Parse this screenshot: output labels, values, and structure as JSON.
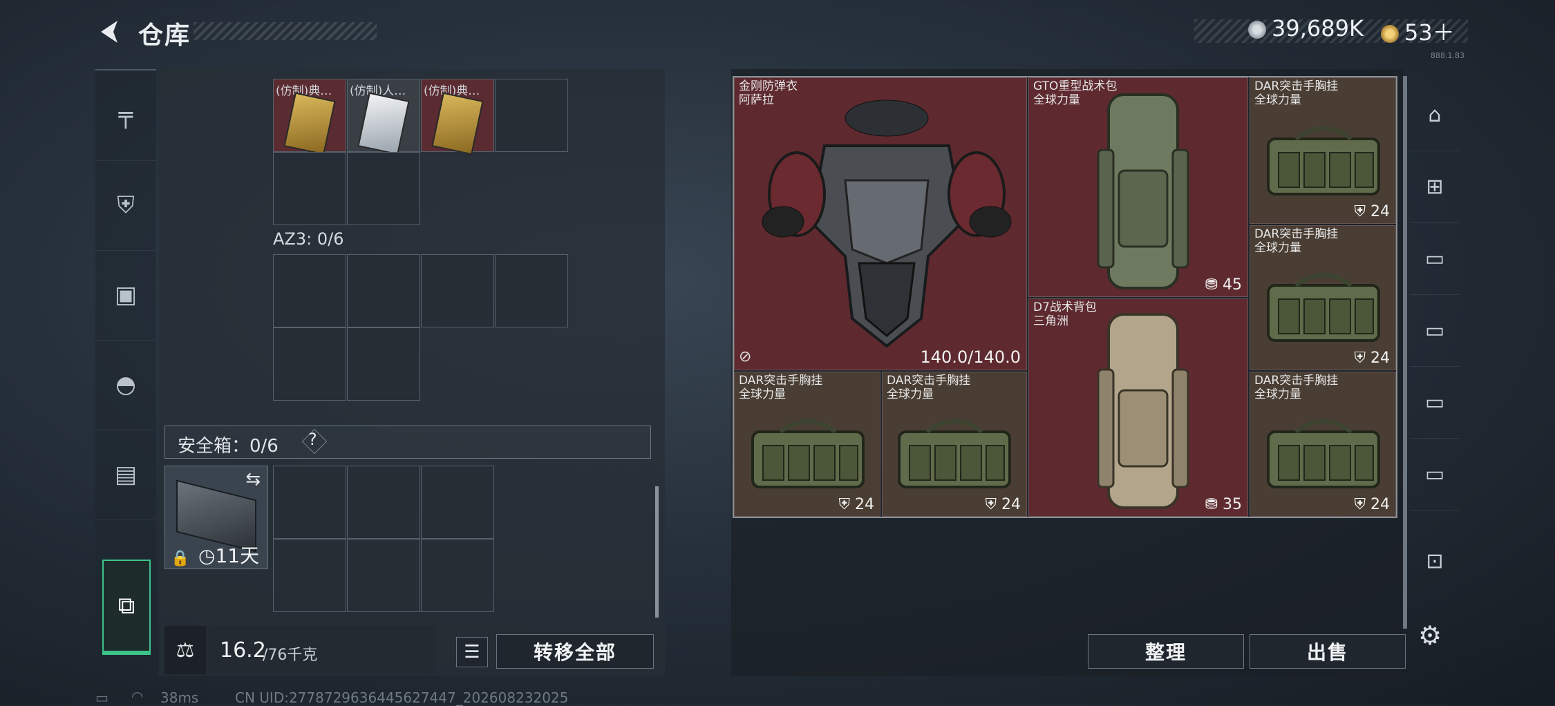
{
  "header": {
    "title": "仓库",
    "currency1_value": "39,689K",
    "currency2_value": "53＋",
    "version": "888.1.83"
  },
  "sidebar": {
    "items": [
      {
        "name": "weapon-icon",
        "glyph": "╤"
      },
      {
        "name": "armor-icon",
        "glyph": "⛨"
      },
      {
        "name": "backpack-icon",
        "glyph": "▣"
      },
      {
        "name": "helmet-icon",
        "glyph": "◓"
      },
      {
        "name": "rig-icon",
        "glyph": "▤"
      },
      {
        "name": "toolbox-icon",
        "glyph": "⧉"
      }
    ]
  },
  "left": {
    "top_items": [
      {
        "label": "(仿制)典…"
      },
      {
        "label": "(仿制)人…"
      },
      {
        "label": "(仿制)典…"
      }
    ],
    "az3_label": "AZ3: 0/6",
    "safebox_label": "安全箱：0/6",
    "safebox_days": "11天",
    "weight_current": "16.2",
    "weight_total": "/76千克",
    "transfer_all": "转移全部"
  },
  "right": {
    "armor": {
      "name": "金刚防弹衣",
      "sub": "阿萨拉",
      "durability": "140.0/140.0"
    },
    "bag1": {
      "name": "GTO重型战术包",
      "sub": "全球力量",
      "count": "45"
    },
    "bag2": {
      "name": "D7战术背包",
      "sub": "三角洲",
      "count": "35"
    },
    "rigs": [
      {
        "name": "DAR突击手胸挂",
        "sub": "全球力量",
        "count": "24"
      },
      {
        "name": "DAR突击手胸挂",
        "sub": "全球力量",
        "count": "24"
      },
      {
        "name": "DAR突击手胸挂",
        "sub": "全球力量",
        "count": "24"
      },
      {
        "name": "DAR突击手胸挂",
        "sub": "全球力量",
        "count": "24"
      },
      {
        "name": "DAR突击手胸挂",
        "sub": "全球力量",
        "count": "24"
      }
    ],
    "sort_button": "整理",
    "sell_button": "出售"
  },
  "right_sidebar": {
    "items": [
      "vault-icon",
      "add-slot-icon",
      "folder-slot-icon",
      "slot-3-icon",
      "slot-4-icon",
      "slot-5-icon",
      "safebox-icon",
      "settings-icon"
    ]
  },
  "status": {
    "ping": "38ms",
    "uid": "CN UID:2778729636445627447_202608232025"
  },
  "colors": {
    "accent": "#3cc38a",
    "item_red": "#5e2a2f",
    "item_olive": "#4a3e34"
  }
}
